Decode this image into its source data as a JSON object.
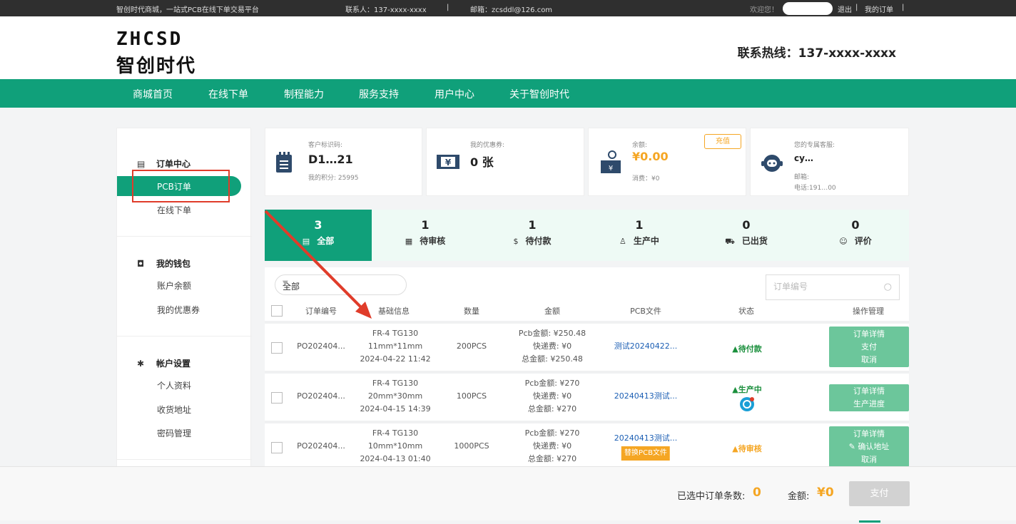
{
  "topbar": {
    "slogan": "智创时代商城，一站式PCB在线下单交易平台",
    "contact": "联系人：137-xxxx-xxxx",
    "email": "邮箱：zcsddl@126.com",
    "sep": "|",
    "welcome": "欢迎您！",
    "logout": "退出",
    "my_orders": "我的订单"
  },
  "header": {
    "logo_en": "ZHCSD",
    "logo_cn": "智创时代",
    "hotline": "联系热线：137-xxxx-xxxx"
  },
  "nav": [
    "商城首页",
    "在线下单",
    "制程能力",
    "服务支持",
    "用户中心",
    "关于智创时代"
  ],
  "sidebar": {
    "order_center": "订单中心",
    "pcb_order": "PCB订单",
    "online_order": "在线下单",
    "wallet": "我的钱包",
    "balance": "账户余额",
    "coupons": "我的优惠券",
    "account": "帐户设置",
    "profile": "个人资料",
    "address": "收货地址",
    "password": "密码管理"
  },
  "cards": {
    "customer_label": "客户标识码:",
    "customer_code": "D1…21",
    "points": "我的积分: 25995",
    "coupon_label": "我的优惠券:",
    "coupon_value": "0 张",
    "balance_label": "余额:",
    "balance_value": "¥0.00",
    "consume": "消费：¥0",
    "recharge": "充值",
    "service_label": "您的专属客服:",
    "service_name": "cy…",
    "service_mail": "邮箱:",
    "service_phone": "电话:191…00"
  },
  "tabs": [
    {
      "count": "3",
      "label": "全部",
      "icon": "▤"
    },
    {
      "count": "1",
      "label": "待审核",
      "icon": "▦"
    },
    {
      "count": "1",
      "label": "待付款",
      "icon": "$"
    },
    {
      "count": "1",
      "label": "生产中",
      "icon": "♙"
    },
    {
      "count": "0",
      "label": "已出货",
      "icon": "⛟"
    },
    {
      "count": "0",
      "label": "评价",
      "icon": "☺"
    }
  ],
  "filter": {
    "selected": "全部"
  },
  "search": {
    "placeholder": "订单编号"
  },
  "table_headers": [
    "订单编号",
    "基础信息",
    "数量",
    "金额",
    "PCB文件",
    "状态",
    "操作管理"
  ],
  "orders": [
    {
      "order_no": "PO202404...",
      "material": "FR-4 TG130",
      "size": "11mm*11mm",
      "date": "2024-04-22 11:42",
      "qty": "200PCS",
      "pcb_amount": "Pcb金额: ¥250.48",
      "shipping": "快递费: ¥0",
      "total": "总金额: ¥250.48",
      "file": "测试20240422...",
      "status": "▲待付款",
      "status_color": "#1a8f3c",
      "ops": [
        "订单详情",
        "支付",
        "取消"
      ]
    },
    {
      "order_no": "PO202404...",
      "material": "FR-4 TG130",
      "size": "20mm*30mm",
      "date": "2024-04-15 14:39",
      "qty": "100PCS",
      "pcb_amount": "Pcb金额: ¥270",
      "shipping": "快递费: ¥0",
      "total": "总金额: ¥270",
      "file": "20240413测试...",
      "status": "▲生产中",
      "status_color": "#1a8f3c",
      "ops": [
        "订单详情",
        "生产进度"
      ]
    },
    {
      "order_no": "PO202404...",
      "material": "FR-4 TG130",
      "size": "10mm*10mm",
      "date": "2024-04-13 01:40",
      "qty": "1000PCS",
      "pcb_amount": "Pcb金额: ¥270",
      "shipping": "快递费: ¥0",
      "total": "总金额: ¥270",
      "file": "20240413测试...",
      "replace_file": "替换PCB文件",
      "status": "▲待审核",
      "status_color": "#f5a623",
      "ops": [
        "订单详情",
        "确认地址",
        "取消"
      ]
    }
  ],
  "footer": {
    "selected_label": "已选中订单条数:",
    "selected_count": "0",
    "amount_label": "金额:",
    "amount_value": "¥0",
    "pay": "支付"
  },
  "colors": {
    "brand": "#10a07a",
    "accent": "#f5a623",
    "annotation": "#e03c2a"
  }
}
